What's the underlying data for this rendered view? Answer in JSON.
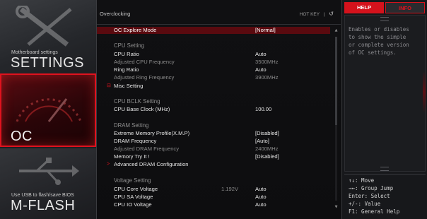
{
  "sidebar": {
    "settings": {
      "sub": "Motherboard settings",
      "title": "SETTINGS"
    },
    "oc": {
      "title": "OC"
    },
    "mflash": {
      "sub": "Use USB to flash/save BIOS",
      "title": "M-FLASH"
    }
  },
  "header": {
    "breadcrumb": "Overclocking",
    "hotkey": "HOT KEY",
    "separator": "|",
    "back_icon": "↺"
  },
  "rows": [
    {
      "label": "OC Explore Mode",
      "value": "[Normal]",
      "kind": "selected"
    },
    {
      "label": "CPU  Setting",
      "kind": "section"
    },
    {
      "label": "CPU Ratio",
      "value": "Auto"
    },
    {
      "label": "Adjusted CPU Frequency",
      "value": "3500MHz",
      "kind": "dim"
    },
    {
      "label": "Ring Ratio",
      "value": "Auto"
    },
    {
      "label": "Adjusted Ring Frequency",
      "value": "3900MHz",
      "kind": "dim"
    },
    {
      "label": "Misc Setting",
      "marker": "⊟"
    },
    {
      "label": "CPU  BCLK  Setting",
      "kind": "section"
    },
    {
      "label": "CPU Base Clock (MHz)",
      "value": "100.00"
    },
    {
      "label": "DRAM  Setting",
      "kind": "section"
    },
    {
      "label": "Extreme Memory Profile(X.M.P)",
      "value": "[Disabled]"
    },
    {
      "label": "DRAM Frequency",
      "value": "[Auto]"
    },
    {
      "label": "Adjusted DRAM Frequency",
      "value": "2400MHz",
      "kind": "dim"
    },
    {
      "label": "Memory Try It !",
      "value": "[Disabled]"
    },
    {
      "label": "Advanced DRAM Configuration",
      "marker": ">"
    },
    {
      "label": "Voltage  Setting",
      "kind": "section"
    },
    {
      "label": "CPU Core Voltage",
      "mid": "1.192V",
      "value": "Auto"
    },
    {
      "label": "CPU SA Voltage",
      "value": "Auto"
    },
    {
      "label": "CPU IO Voltage",
      "value": "Auto"
    }
  ],
  "help": {
    "tab_help": "HELP",
    "tab_info": "INFO",
    "lines": [
      "Enables or disables",
      "to show the simple",
      "or complete version",
      "of OC settings."
    ],
    "keys": [
      "↑↓: Move",
      "→←: Group Jump",
      "Enter: Select",
      "+/-: Value",
      "F1: General Help"
    ]
  },
  "colors": {
    "accent": "#d4121c",
    "selected_row": "#5a0a0f",
    "background": "#0d0d0f"
  }
}
